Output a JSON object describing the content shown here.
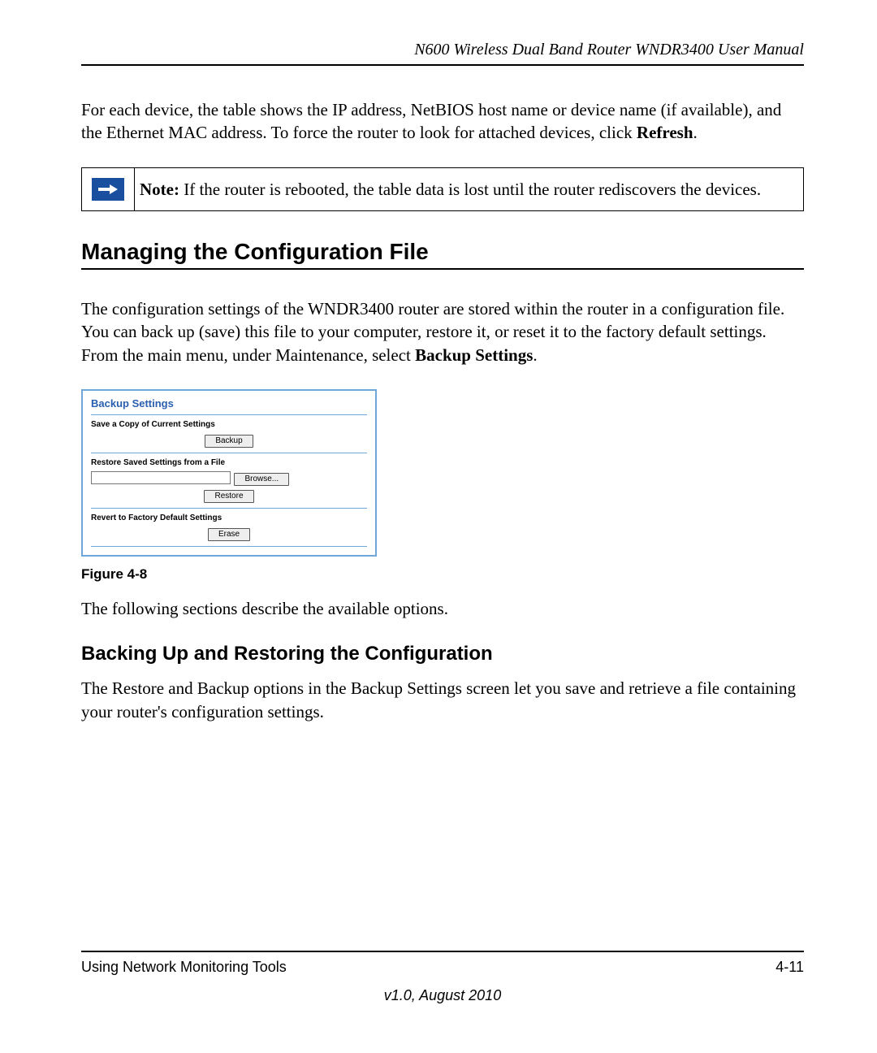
{
  "header": {
    "running_title": "N600 Wireless Dual Band Router WNDR3400 User Manual"
  },
  "intro": {
    "para_pre": "For each device, the table shows the IP address, NetBIOS host name or device name (if available), and the Ethernet MAC address. To force the router to look for attached devices, click ",
    "para_bold": "Refresh",
    "para_post": "."
  },
  "note": {
    "label": "Note:",
    "text": " If the router is rebooted, the table data is lost until the router rediscovers the devices."
  },
  "section1": {
    "heading": "Managing the Configuration File",
    "para_pre": "The configuration settings of the WNDR3400 router are stored within the router in a configuration file. You can back up (save) this file to your computer, restore it, or reset it to the factory default settings. From the main menu, under Maintenance, select ",
    "para_bold": "Backup Settings",
    "para_post": "."
  },
  "figure": {
    "panel_title": "Backup Settings",
    "save_label": "Save a Copy of Current Settings",
    "backup_btn": "Backup",
    "restore_label": "Restore Saved Settings from a File",
    "browse_btn": "Browse...",
    "restore_btn": "Restore",
    "revert_label": "Revert to Factory Default Settings",
    "erase_btn": "Erase",
    "caption": "Figure 4-8"
  },
  "after_figure": "The following sections describe the available options.",
  "subsection": {
    "heading": "Backing Up and Restoring the Configuration",
    "para": "The Restore and Backup options in the Backup Settings screen let you save and retrieve a file containing your router's configuration settings."
  },
  "footer": {
    "left": "Using Network Monitoring Tools",
    "right": "4-11",
    "version": "v1.0, August 2010"
  }
}
